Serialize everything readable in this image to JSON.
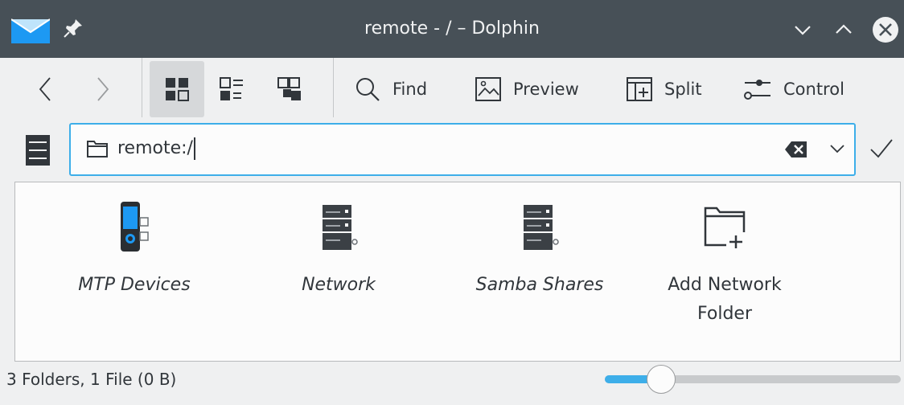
{
  "window": {
    "title": "remote - / – Dolphin",
    "app_icon": "dolphin-app-icon",
    "controls": [
      "minimize-icon",
      "maximize-icon",
      "close-icon"
    ]
  },
  "toolbar": {
    "back_icon": "chevron-left-icon",
    "forward_icon": "chevron-right-icon",
    "view_modes": [
      "icons-view-icon",
      "compact-view-icon",
      "details-view-icon"
    ],
    "find_label": "Find",
    "preview_label": "Preview",
    "split_label": "Split",
    "control_label": "Control"
  },
  "location": {
    "path": "remote:/",
    "folder_icon": "folder-icon",
    "clear_icon": "clear-text-icon",
    "dropdown_icon": "chevron-down-icon",
    "accept_icon": "checkmark-icon"
  },
  "items": [
    {
      "label": "MTP Devices",
      "icon": "mtp-device-icon",
      "italic": true
    },
    {
      "label": "Network",
      "icon": "network-server-icon",
      "italic": true
    },
    {
      "label": "Samba Shares",
      "icon": "network-server-icon",
      "italic": true
    },
    {
      "label": "Add Network Folder",
      "line1": "Add Network",
      "line2": "Folder",
      "icon": "folder-add-icon",
      "italic": false
    }
  ],
  "status": {
    "text": "3 Folders, 1 File (0 B)",
    "zoom_level": 0.14
  },
  "colors": {
    "titlebar": "#475057",
    "accent": "#3daee9",
    "background": "#eff0f1",
    "view": "#fcfcfc"
  }
}
